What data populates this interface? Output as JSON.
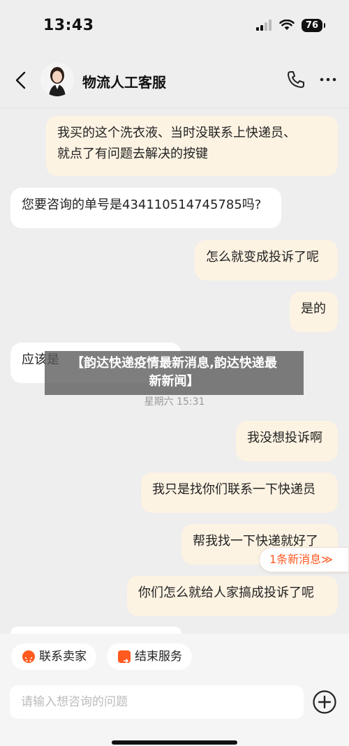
{
  "status_bar": {
    "time": "13:43",
    "battery": "76"
  },
  "header": {
    "title": "物流人工客服"
  },
  "messages": [
    {
      "side": "user",
      "lines": [
        "我买的这个洗衣液、当时没联系上快递员、",
        "就点了有问题去解决的按键"
      ]
    },
    {
      "side": "agent",
      "text": "您要咨询的单号是434110514745785吗?"
    },
    {
      "side": "user",
      "text": "怎么就变成投诉了呢"
    },
    {
      "side": "user",
      "text": "是的"
    },
    {
      "side": "agent",
      "text": "应该是"
    },
    {
      "side": "user",
      "text": "我没想投诉啊"
    },
    {
      "side": "user",
      "text": "我只是找你们联系一下快递员"
    },
    {
      "side": "user",
      "text": "帮我找一下快递就好了"
    },
    {
      "side": "user",
      "text": "你们怎么就给人家搞成投诉了呢"
    }
  ],
  "timestamp": "星期六 15:31",
  "overlay_title": [
    "【韵达快递疫情最新消息,韵达快递最",
    "新新闻】"
  ],
  "new_message_pill": "1条新消息≫",
  "quick_actions": {
    "contact_seller": "联系卖家",
    "end_service": "结束服务"
  },
  "input": {
    "placeholder": "请输入想咨询的问题"
  },
  "colors": {
    "accent": "#ff5a1f",
    "user_bubble": "#fdf3e3",
    "agent_bubble": "#ffffff",
    "background": "#eeeeee"
  }
}
